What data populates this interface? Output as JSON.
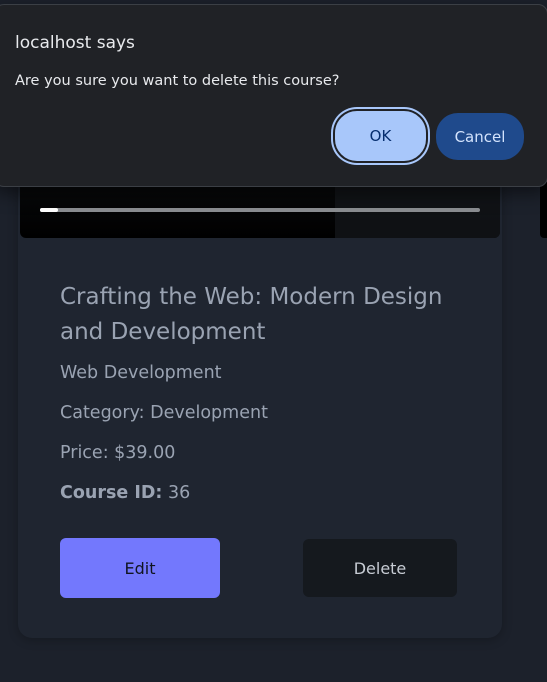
{
  "dialog": {
    "title": "localhost says",
    "message": "Are you sure you want to delete this course?",
    "ok_label": "OK",
    "cancel_label": "Cancel"
  },
  "course": {
    "title": "Crafting the Web: Modern Design and Development",
    "subtitle": "Web Development",
    "category": "Category: Development",
    "price": "Price: $39.00",
    "id_label": "Course ID:",
    "id_value": "36",
    "edit_label": "Edit",
    "delete_label": "Delete",
    "video_progress": 0.04
  },
  "colors": {
    "background": "#1c212b",
    "card": "#1f2530",
    "edit_button": "#7378fd",
    "delete_button": "#15191e",
    "dialog_ok": "#a8c7fa",
    "dialog_cancel": "#1f4a8c"
  }
}
